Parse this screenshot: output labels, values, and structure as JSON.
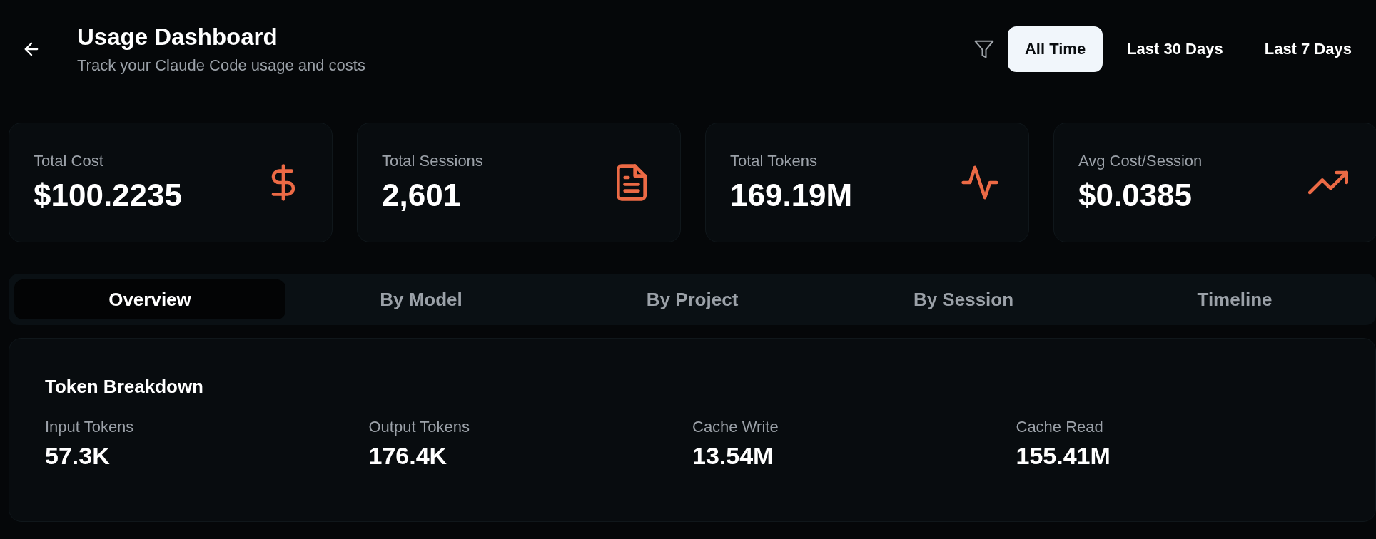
{
  "header": {
    "title": "Usage Dashboard",
    "subtitle": "Track your Claude Code usage and costs"
  },
  "ranges": [
    {
      "label": "All Time",
      "selected": true
    },
    {
      "label": "Last 30 Days",
      "selected": false
    },
    {
      "label": "Last 7 Days",
      "selected": false
    }
  ],
  "stats": [
    {
      "label": "Total Cost",
      "value": "$100.2235"
    },
    {
      "label": "Total Sessions",
      "value": "2,601"
    },
    {
      "label": "Total Tokens",
      "value": "169.19M"
    },
    {
      "label": "Avg Cost/Session",
      "value": "$0.0385"
    }
  ],
  "tabs": [
    {
      "label": "Overview",
      "selected": true
    },
    {
      "label": "By Model",
      "selected": false
    },
    {
      "label": "By Project",
      "selected": false
    },
    {
      "label": "By Session",
      "selected": false
    },
    {
      "label": "Timeline",
      "selected": false
    }
  ],
  "breakdown": {
    "title": "Token Breakdown",
    "items": [
      {
        "label": "Input Tokens",
        "value": "57.3K"
      },
      {
        "label": "Output Tokens",
        "value": "176.4K"
      },
      {
        "label": "Cache Write",
        "value": "13.54M"
      },
      {
        "label": "Cache Read",
        "value": "155.41M"
      }
    ]
  }
}
